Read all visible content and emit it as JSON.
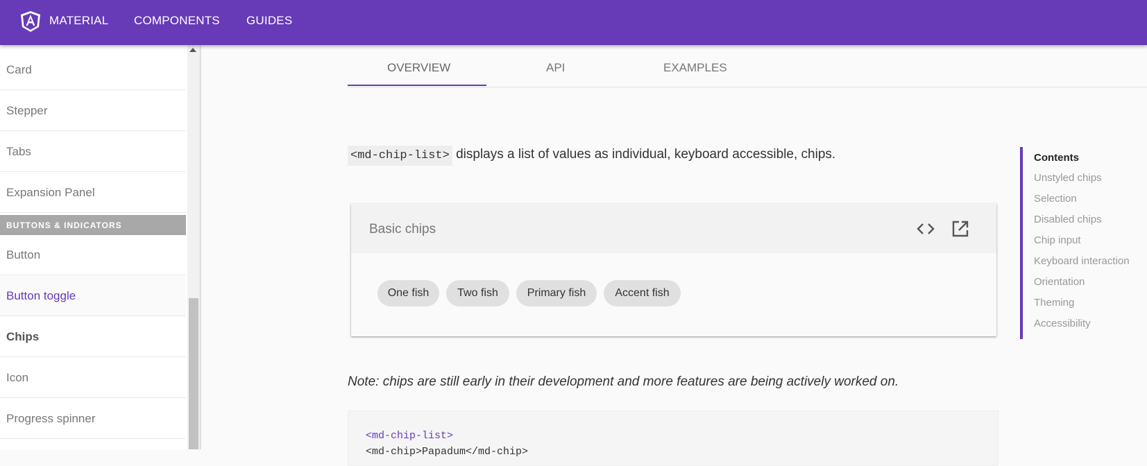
{
  "toolbar": {
    "brand": "MATERIAL",
    "links": [
      "COMPONENTS",
      "GUIDES"
    ],
    "color": "#673ab7"
  },
  "sidebar": {
    "items_top": [
      "Card",
      "Stepper",
      "Tabs",
      "Expansion Panel"
    ],
    "section_header": "BUTTONS & INDICATORS",
    "items_bottom": [
      "Button",
      "Button toggle",
      "Chips",
      "Icon",
      "Progress spinner"
    ]
  },
  "tabs": [
    "OVERVIEW",
    "API",
    "EXAMPLES"
  ],
  "intro": {
    "code": "<md-chip-list>",
    "text": " displays a list of values as individual, keyboard accessible, chips."
  },
  "example": {
    "title": "Basic chips",
    "code_icon": "code-icon",
    "open_icon": "open-in-new-icon",
    "chips": [
      "One fish",
      "Two fish",
      "Primary fish",
      "Accent fish"
    ]
  },
  "note": "Note: chips are still early in their development and more features are being actively worked on.",
  "codeblock": {
    "line1": "<md-chip-list>",
    "line2": "  <md-chip>Papadum</md-chip>"
  },
  "toc": {
    "title": "Contents",
    "items": [
      "Unstyled chips",
      "Selection",
      "Disabled chips",
      "Chip input",
      "Keyboard interaction",
      "Orientation",
      "Theming",
      "Accessibility"
    ]
  }
}
